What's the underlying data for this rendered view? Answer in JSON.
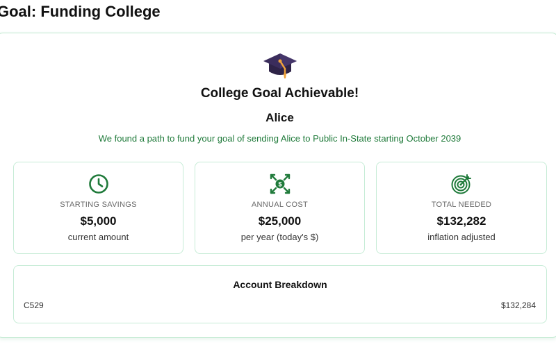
{
  "page": {
    "title": "Goal: Funding College"
  },
  "hero": {
    "icon": "graduation-cap-icon",
    "heading": "College Goal Achievable!",
    "student_name": "Alice",
    "summary": "We found a path to fund your goal of sending Alice to Public In-State starting October 2039"
  },
  "stats": [
    {
      "icon": "clock-icon",
      "label": "STARTING SAVINGS",
      "value": "$5,000",
      "sub": "current amount"
    },
    {
      "icon": "money-expand-icon",
      "label": "ANNUAL COST",
      "value": "$25,000",
      "sub": "per year (today's $)"
    },
    {
      "icon": "target-icon",
      "label": "TOTAL NEEDED",
      "value": "$132,282",
      "sub": "inflation adjusted"
    }
  ],
  "breakdown": {
    "title": "Account Breakdown",
    "rows": [
      {
        "account": "C529",
        "amount": "$132,284"
      }
    ]
  },
  "colors": {
    "accent_green": "#1f7a3a",
    "border_green": "#c6ecd6",
    "cap_dark": "#3b2d5c",
    "tassel": "#f0a23a"
  }
}
